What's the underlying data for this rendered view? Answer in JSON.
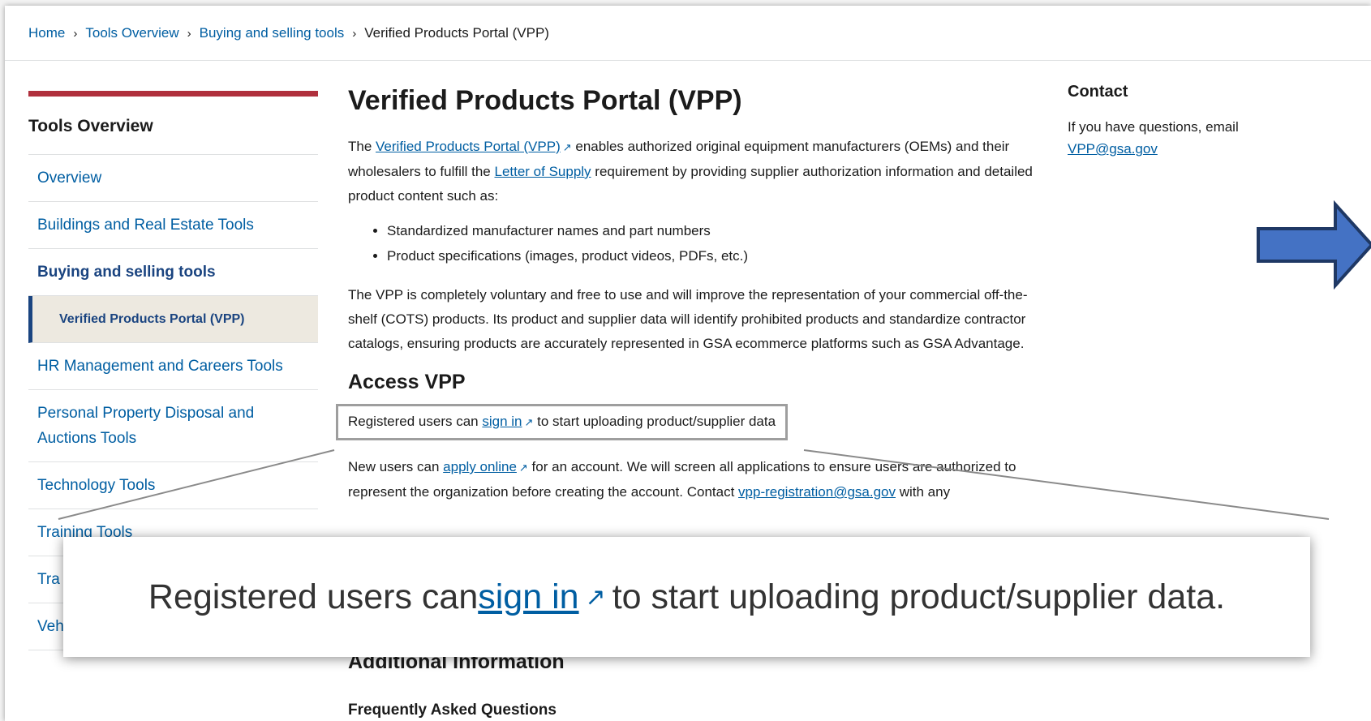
{
  "breadcrumb": [
    {
      "label": "Home",
      "link": true
    },
    {
      "label": "Tools Overview",
      "link": true
    },
    {
      "label": "Buying and selling tools",
      "link": true
    },
    {
      "label": "Verified Products Portal (VPP)",
      "link": false
    }
  ],
  "breadcrumb_separator": "›",
  "sidebar": {
    "title": "Tools Overview",
    "items": [
      {
        "label": "Overview"
      },
      {
        "label": "Buildings and Real Estate Tools"
      },
      {
        "label": "Buying and selling tools"
      },
      {
        "label": "Verified Products Portal (VPP)"
      },
      {
        "label": "HR Management and Careers Tools"
      },
      {
        "label": "Personal Property Disposal and Auctions Tools"
      },
      {
        "label": "Technology Tools"
      },
      {
        "label": "Training Tools"
      },
      {
        "label": "Tra"
      },
      {
        "label": "Veh"
      }
    ]
  },
  "main": {
    "title": "Verified Products Portal (VPP)",
    "intro": {
      "p1": "The ",
      "link1": "Verified Products Portal (VPP)",
      "p2": " enables authorized original equipment manufacturers (OEMs) and their wholesalers to fulfill the ",
      "link2": "Letter of Supply",
      "p3": " requirement by providing supplier authorization information and detailed product content such as:"
    },
    "bullets": [
      "Standardized manufacturer names and part numbers",
      "Product specifications (images, product videos, PDFs, etc.)"
    ],
    "para2": "The VPP is completely voluntary and free to use and will improve the representation of your commercial off-the-shelf (COTS) products. Its product and supplier data will identify prohibited products and standardize contractor catalogs, ensuring products are accurately represented in GSA ecommerce platforms such as GSA Advantage.",
    "access_heading": "Access VPP",
    "registered": {
      "pre": "Registered users can ",
      "link": "sign in",
      "post": " to start uploading product/supplier data"
    },
    "new_users": {
      "pre": "New users can ",
      "link": "apply online",
      "mid": " for an account. We will screen all applications to ensure users are authorized to represent the organization before creating the account. Contact ",
      "email": "vpp-registration@gsa.gov",
      "post": " with any"
    },
    "additional_heading": "Additional Information",
    "faq_heading": "Frequently Asked Questions"
  },
  "contact": {
    "title": "Contact",
    "text": "If you have questions, email ",
    "email": "VPP@gsa.gov"
  },
  "callout": {
    "pre": "Registered users can ",
    "link": "sign in",
    "post": " to start uploading product/supplier data."
  },
  "icons": {
    "external": "↗",
    "arrow": "right-arrow"
  },
  "colors": {
    "link": "#005ea2",
    "accent_red": "#b0303d",
    "arrow_fill": "#4472c4",
    "arrow_stroke": "#1f3864"
  }
}
